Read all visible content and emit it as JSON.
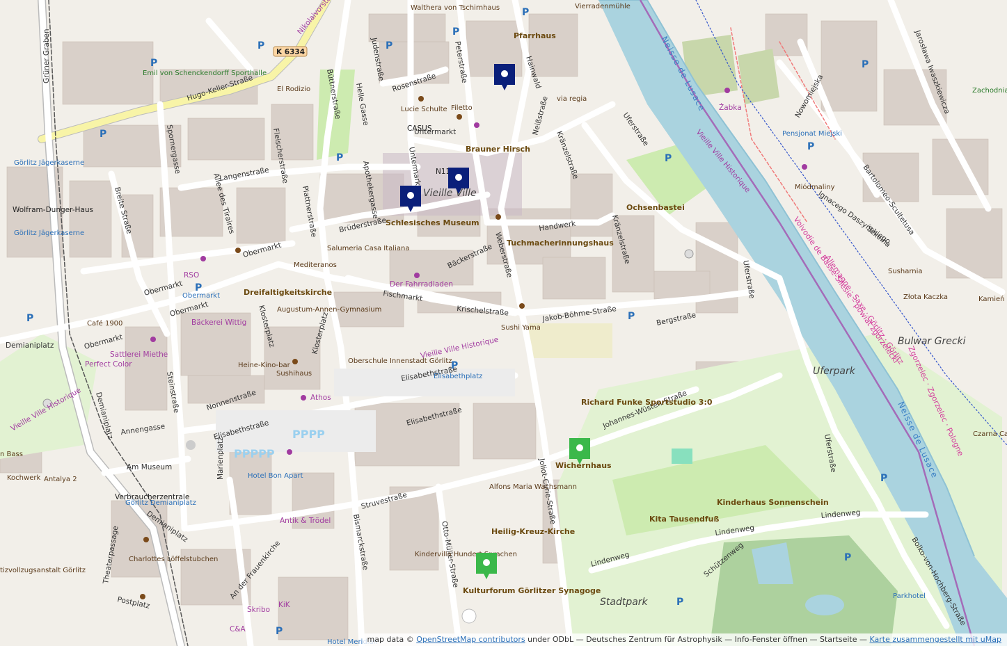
{
  "attribution": {
    "prefix": "map data ©",
    "osm_link": "OpenStreetMap contributors",
    "license": "under ODbL — Deutsches Zentrum für Astrophysik — Info-Fenster öffnen — Startseite —",
    "umap_link": "Karte zusammengestellt mit uMap"
  },
  "streets": {
    "hugo_keller": "Hugo-Keller-Straße",
    "k6334": "K 6334",
    "nikolaivorstadt": "Nikolaivorstadt",
    "judenstrasse": "Judenstraße",
    "rosenstrasse": "Rosenstraße",
    "peterstrasse": "Peterstraße",
    "hainwald": "Hainwald",
    "neissstrasse": "Neißstraße",
    "untermarkt": "Untermarkt",
    "untermarkt2": "Untermarkt",
    "langenstrasse": "Langenstraße",
    "plattnerstrasse": "Plattnerstraße",
    "fleischerstrasse": "Fleischerstraße",
    "buettnerstrasse": "Büttnerstraße",
    "helle_gasse": "Helle Gasse",
    "apothekergasse": "Apothekergasse",
    "spornergasse": "Spornergasse",
    "breite_strasse": "Breite Straße",
    "allee": "Allee des Tiraires",
    "obermarkt1": "Obermarkt",
    "obermarkt2": "Obermarkt",
    "obermarkt3": "Obermarkt",
    "obermarkt4": "Obermarkt",
    "bruederstrasse": "Brüderstraße",
    "baeckerstrasse": "Bäckerstraße",
    "weberstrasse": "Weberstraße",
    "handwerk": "Handwerk",
    "kraenzelstrasse": "Kränzelstraße",
    "kraenzelstrasse2": "Kränzelstraße",
    "uferstrasse": "Uferstraße",
    "uferstrasse2": "Uferstraße",
    "uferstrasse3": "Uferstraße",
    "fischmarkt": "Fischmarkt",
    "krischelstrasse": "Krischelstraße",
    "jakob_boehme": "Jakob-Böhme-Straße",
    "bergstrasse": "Bergstraße",
    "klosterplatz": "Klosterplatz",
    "klosterplatz2": "Klosterplatz",
    "elisabethstrasse1": "Elisabethstraße",
    "elisabethstrasse2": "Elisabethstraße",
    "elisabethstrasse3": "Elisabethstraße",
    "johannes_wuesten": "Johannes-Wüsten-Straße",
    "nonnenstrasse": "Nonnenstraße",
    "steinstrasse": "Steinstraße",
    "annengasse": "Annengasse",
    "am_museum": "Am Museum",
    "demianiplatz1": "Demianiplatz",
    "demianiplatz2": "Demianiplatz",
    "demianiplatz3": "Demianiplatz",
    "gruener_graben": "Grüner Graben",
    "marienplatz": "Marienplatz",
    "struvestrasse": "Struvestraße",
    "bismarckstrasse": "Bismarckstraße",
    "otto_mueller": "Otto-Müller-Straße",
    "joliot_curie": "Joliot-Curie-Straße",
    "lindenweg1": "Lindenweg",
    "lindenweg2": "Lindenweg",
    "lindenweg3": "Lindenweg",
    "schuetzenweg": "Schützenweg",
    "theaterpassage": "Theaterpassage",
    "postplatz": "Postplatz",
    "an_der_frauenkirche": "An der Frauenkirche",
    "jaroslawa": "Jarosława Iwaszkiewicza",
    "nowomiejska": "Nowomiejska",
    "bartolomeo": "Bartolomeo-Scultetusa",
    "szkolna": "Szkolna",
    "ignacego": "Ignacego Daszyńskiego",
    "bolko": "Bolko-von-Hochberg-Straße",
    "bulwar": "Bulwar Grecki"
  },
  "places": {
    "pfarrhaus": "Pfarrhaus",
    "vierradenmuehle": "Vierradenmühle",
    "waltherhaus": "Walthera von Tschirnhaus",
    "emil": "Emil von Schenckendorff Sporthalle",
    "el_rodizio": "El Rodizio",
    "lucie_schulte": "Lucie Schulte",
    "filetto": "Filetto",
    "casus": "CASUS",
    "brauner_hirsch": "Brauner Hirsch",
    "via_regia": "via regia",
    "n11": "N11",
    "goerlitz_vielle": "Vieille Ville",
    "schlesisches": "Schlesisches Museum",
    "tuchmacher": "Tuchmacherinnungshaus",
    "ochsenbastei": "Ochsenbastei",
    "salumeria": "Salumeria Casa Italiana",
    "mediteranos": "Mediteranos",
    "fahrradladen": "Der Fahrradladen",
    "dreifaltigkeit": "Dreifaltigkeitskirche",
    "augustum": "Augustum-Annen-Gymnasium",
    "rso": "RSO",
    "obermarkt_p": "Obermarkt",
    "baeckerei": "Bäckerei Wittig",
    "cafe1900": "Café 1900",
    "sattlerei": "Sattlerei Miethe",
    "perfect_color": "Perfect Color",
    "heine_kino": "Heine-Kino-bar",
    "sushihaus": "Sushihaus",
    "athos": "Athos",
    "sushi_yama": "Sushi Yama",
    "oberschule": "Oberschule Innenstadt Görlitz",
    "elisabethplatz": "Elisabethplatz",
    "vieille_ville_historique1": "Vieille Ville Historique",
    "vieille_ville_historique2": "Vieille Ville Historique",
    "vieille_ville_historique3": "Vieille Ville Historique",
    "richard_funke": "Richard Funke Sportstudio 3:0",
    "wichernhaus": "Wichernhaus",
    "alfons": "Alfons Maria Wachsmann",
    "heilig_kreuz": "Heilig-Kreuz-Kirche",
    "kindervilla": "Kindervilla Hundert Sprachen",
    "kulturforum": "Kulturforum Görlitzer Synagoge",
    "kita": "Kita Tausendfuß",
    "kinderhaus": "Kinderhaus Sonnenschein",
    "uferpark": "Uferpark",
    "stadtpark": "Stadtpark",
    "parkhotel": "Parkhotel",
    "hotel_bon_apart": "Hotel Bon Apart",
    "antik": "Antik & Trödel",
    "verbraucherzentrale": "Verbraucherzentrale",
    "goerlitz_demiani": "Görlitz Demianiplatz",
    "charlottes": "Charlottes Löffelstubchen",
    "skribo": "Skribo",
    "kik": "KiK",
    "ca": "C&A",
    "hotel_meridian": "Hotel Meridian",
    "kochwerk": "Kochwerk",
    "antalya": "Antalya 2",
    "bass": "n Bass",
    "vollzugsanstalt": "tizvollzugsanstalt Görlitz",
    "jaegerkaserne1": "Görlitz Jägerkaserne",
    "jaegerkaserne2": "Görlitz Jägerkaserne",
    "wolfram": "Wolfram-Dunger-Haus",
    "pensjonat": "Pensjonat Miejski",
    "zabka": "Żabka",
    "miodmaliny": "Miódmaliny",
    "susharnia": "Susharnia",
    "zlota_kaczka": "Złota Kaczka",
    "kamien": "Kamień",
    "czarna_ca": "Czarna Ca",
    "zachodnia": "Zachodnia",
    "neisse_lusace": "Neisse de Lusace",
    "neisse_lusace2": "Neisse de Lusace",
    "voivodie": "Voivodie de Basse-Silésie – powiat zgorzelecki",
    "allemagne": "Allemagne · Saxe · Görlitz · Görlitz",
    "zgorzelec": "Zgorzelec · Zgorzelec · Pologne"
  },
  "markers": [
    {
      "name": "marker-navy-1",
      "color": "#0a1f7a"
    },
    {
      "name": "marker-navy-2",
      "color": "#0a1f7a"
    },
    {
      "name": "marker-navy-3",
      "color": "#0a1f7a"
    },
    {
      "name": "marker-green-1",
      "color": "#3bb84a"
    },
    {
      "name": "marker-green-2",
      "color": "#3bb84a"
    }
  ],
  "colors": {
    "building": "#d9d0c9",
    "oldtown_building": "#c9b8c4",
    "road": "#ffffff",
    "primary_road": "#fcd6a4",
    "river": "#aad3df",
    "park": "#cdebb0",
    "forest": "#add19e",
    "pitch": "#88e0be",
    "blue_marker": "#0a1f7a",
    "green_marker": "#3bb84a"
  }
}
